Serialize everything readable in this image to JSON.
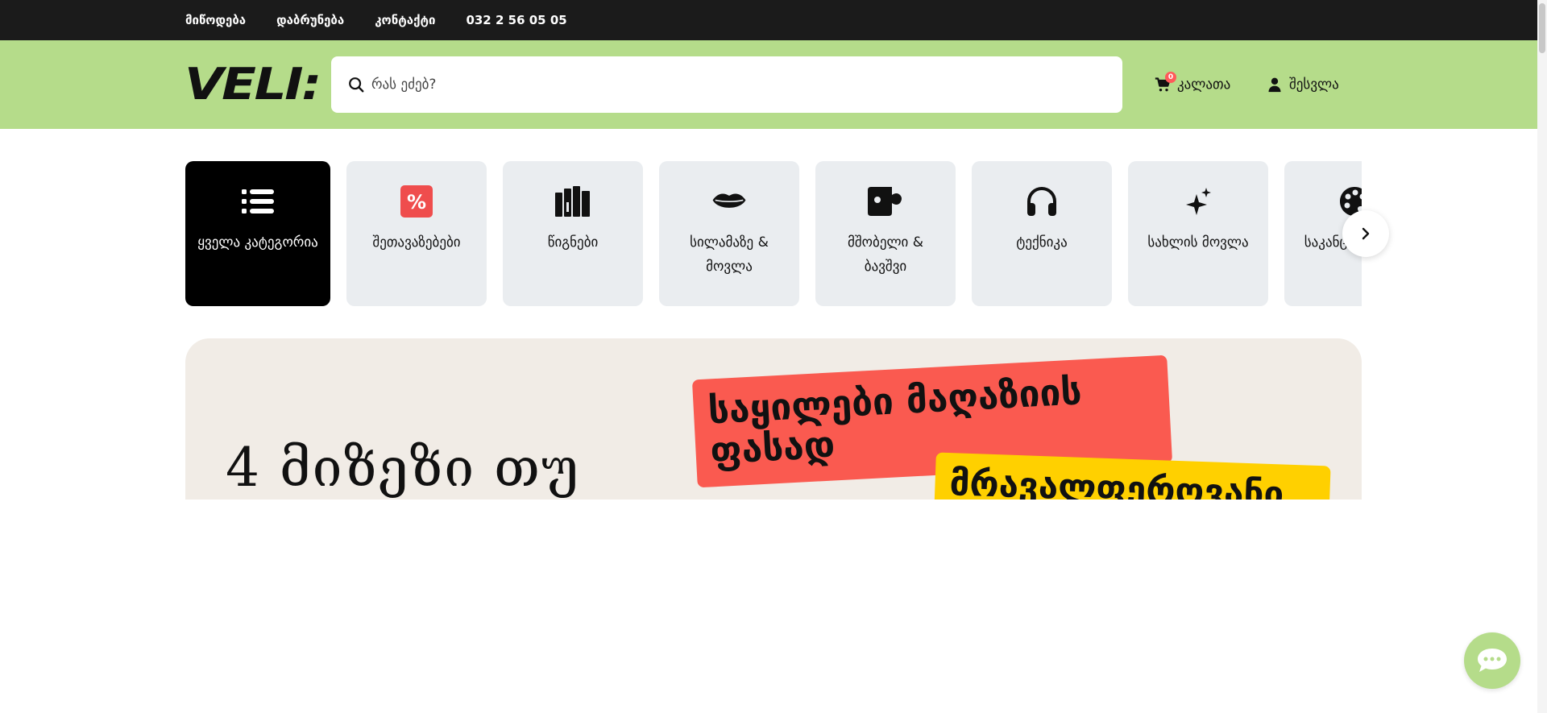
{
  "topbar": {
    "links": [
      "მიწოდება",
      "დაბრუნება",
      "კონტაქტი",
      "032 2 56 05 05"
    ]
  },
  "header": {
    "logo_text": "VELI:",
    "search": {
      "placeholder": "რას ეძებ?"
    },
    "cart": {
      "label": "კალათა",
      "count": "0"
    },
    "login": {
      "label": "შესვლა"
    }
  },
  "categories": [
    {
      "label": "ყველა კატეგორია",
      "icon": "list-icon"
    },
    {
      "label": "შეთავაზებები",
      "icon": "percent-icon"
    },
    {
      "label": "წიგნები",
      "icon": "books-icon"
    },
    {
      "label": "სილამაზე & მოვლა",
      "icon": "lips-icon"
    },
    {
      "label": "მშობელი & ბავშვი",
      "icon": "puzzle-icon"
    },
    {
      "label": "ტექნიკა",
      "icon": "headphones-icon"
    },
    {
      "label": "სახლის მოვლა",
      "icon": "sparkle-icon"
    },
    {
      "label": "საკანცელარიო",
      "icon": "palette-icon"
    }
  ],
  "banner": {
    "title": "4 მიზეზი თუ",
    "red_sticker": "საყილები მაღაზიის ფასად",
    "yellow_sticker": "მრავალფეროვანი"
  },
  "colors": {
    "topbar": "#1b1b1b",
    "header": "#b5dc8a",
    "accent_red": "#fa5a50",
    "accent_yellow": "#ffd000",
    "category_bg": "#eaedf0"
  }
}
